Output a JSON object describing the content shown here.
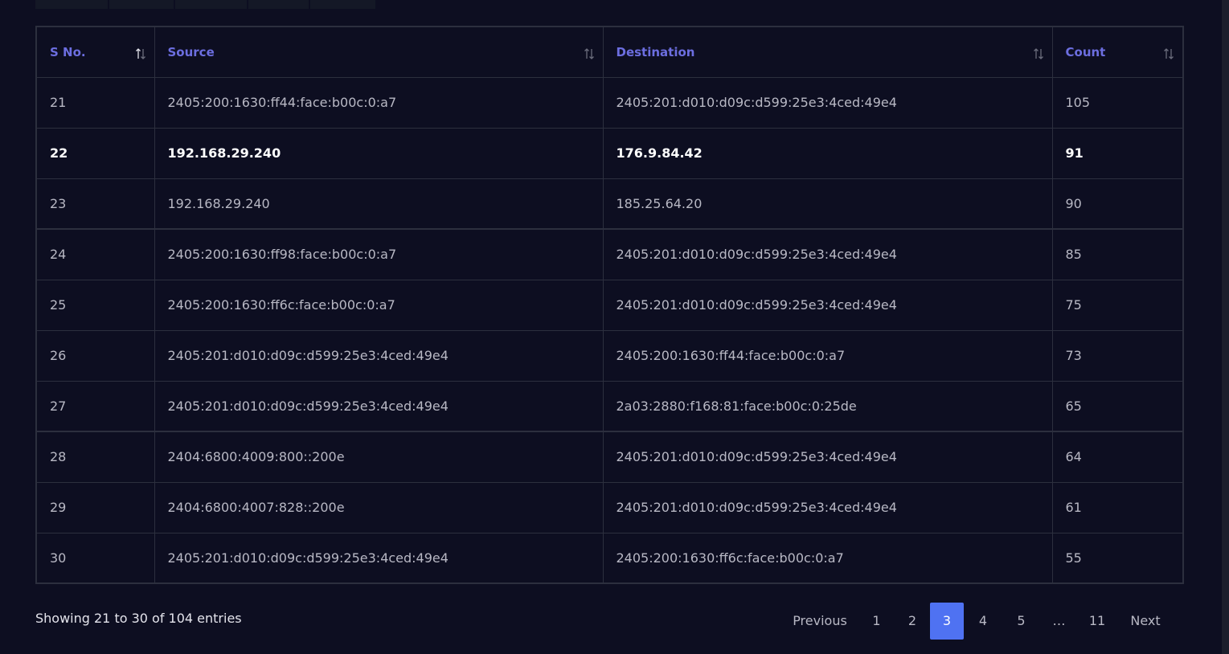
{
  "table": {
    "headers": [
      "S No.",
      "Source",
      "Destination",
      "Count"
    ],
    "rows": [
      {
        "sno": "21",
        "source": "2405:200:1630:ff44:face:b00c:0:a7",
        "destination": "2405:201:d010:d09c:d599:25e3:4ced:49e4",
        "count": "105"
      },
      {
        "sno": "22",
        "source": "192.168.29.240",
        "destination": "176.9.84.42",
        "count": "91"
      },
      {
        "sno": "23",
        "source": "192.168.29.240",
        "destination": "185.25.64.20",
        "count": "90"
      },
      {
        "sno": "24",
        "source": "2405:200:1630:ff98:face:b00c:0:a7",
        "destination": "2405:201:d010:d09c:d599:25e3:4ced:49e4",
        "count": "85"
      },
      {
        "sno": "25",
        "source": "2405:200:1630:ff6c:face:b00c:0:a7",
        "destination": "2405:201:d010:d09c:d599:25e3:4ced:49e4",
        "count": "75"
      },
      {
        "sno": "26",
        "source": "2405:201:d010:d09c:d599:25e3:4ced:49e4",
        "destination": "2405:200:1630:ff44:face:b00c:0:a7",
        "count": "73"
      },
      {
        "sno": "27",
        "source": "2405:201:d010:d09c:d599:25e3:4ced:49e4",
        "destination": "2a03:2880:f168:81:face:b00c:0:25de",
        "count": "65"
      },
      {
        "sno": "28",
        "source": "2404:6800:4009:800::200e",
        "destination": "2405:201:d010:d09c:d599:25e3:4ced:49e4",
        "count": "64"
      },
      {
        "sno": "29",
        "source": "2404:6800:4007:828::200e",
        "destination": "2405:201:d010:d09c:d599:25e3:4ced:49e4",
        "count": "61"
      },
      {
        "sno": "30",
        "source": "2405:201:d010:d09c:d599:25e3:4ced:49e4",
        "destination": "2405:200:1630:ff6c:face:b00c:0:a7",
        "count": "55"
      }
    ]
  },
  "footer": {
    "info": "Showing 21 to 30 of 104 entries"
  },
  "pagination": {
    "previous": "Previous",
    "pages": [
      "1",
      "2",
      "3",
      "4",
      "5"
    ],
    "ellipsis": "…",
    "last": "11",
    "next": "Next",
    "current": "3"
  },
  "colors": {
    "background": "#0d0e21",
    "header_text": "#6c6ee0",
    "active_page": "#4f72f2"
  },
  "icons": {
    "sort": "sort-arrows-icon"
  }
}
